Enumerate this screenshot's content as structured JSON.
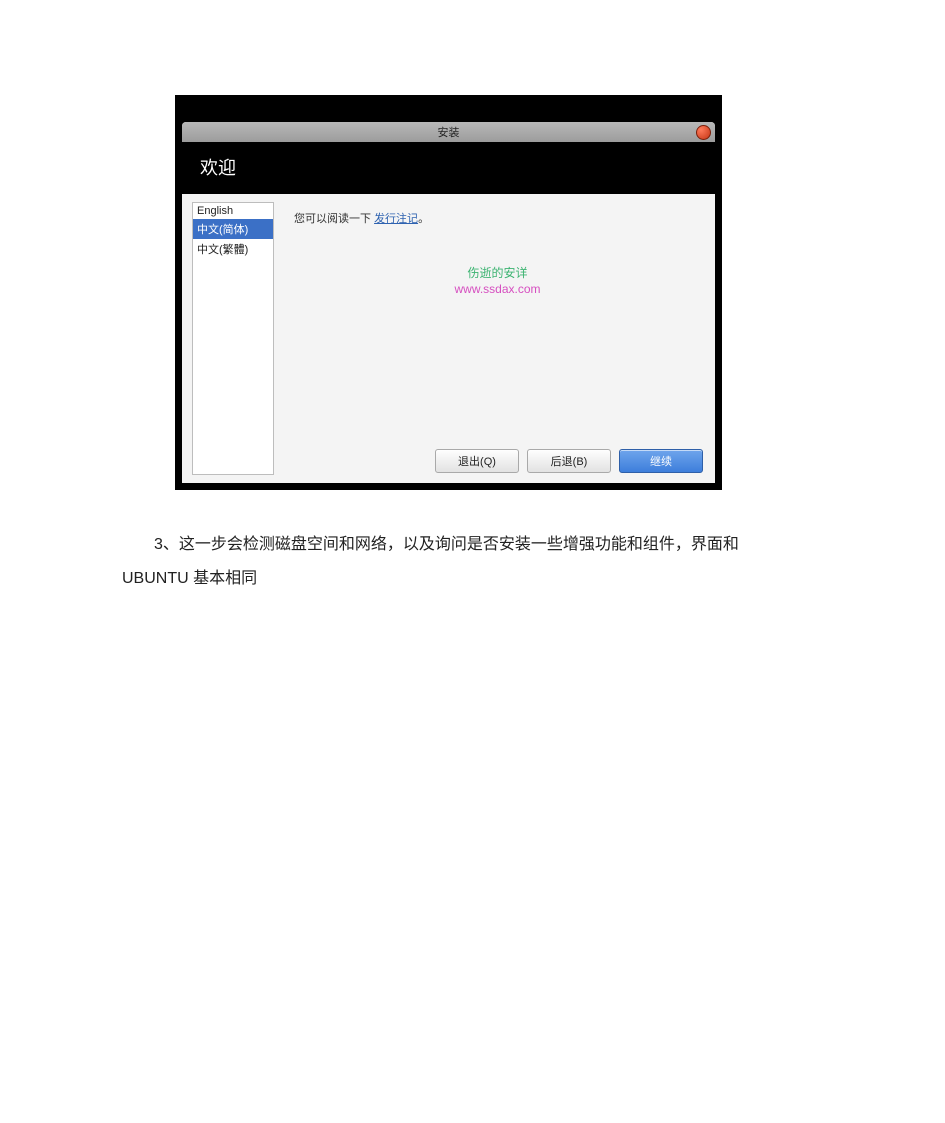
{
  "installer": {
    "titlebar": "安装",
    "header": "欢迎",
    "languages": [
      "English",
      "中文(简体)",
      "中文(繁體)"
    ],
    "selected_language_index": 1,
    "message_prefix": "您可以阅读一下 ",
    "release_notes_link": "发行注记",
    "message_suffix": "。",
    "watermark_top": "伤逝的安详",
    "watermark_bottom": "www.ssdax.com",
    "buttons": {
      "quit": "退出(Q)",
      "back": "后退(B)",
      "continue": "继续"
    }
  },
  "doc": {
    "line1": "3、这一步会检测磁盘空间和网络，以及询问是否安装一些增强功能和组件，界面和",
    "line2": "UBUNTU 基本相同"
  }
}
